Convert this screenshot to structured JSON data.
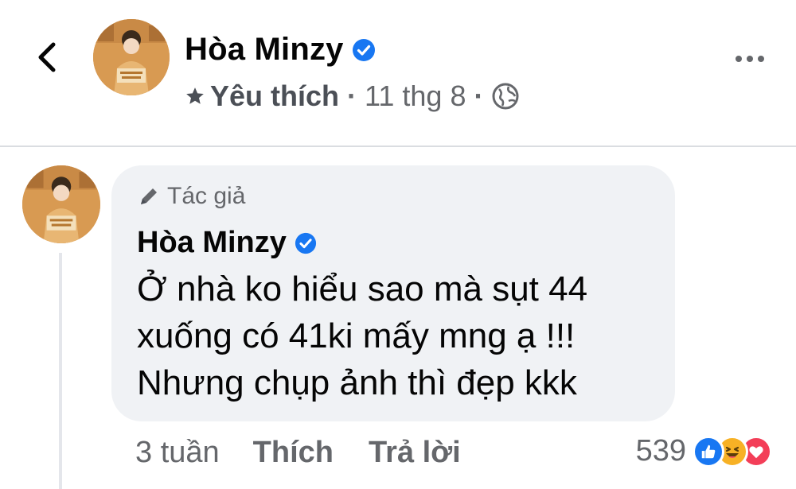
{
  "header": {
    "author_name": "Hòa Minzy",
    "favorite_label": "Yêu thích",
    "separator": "·",
    "date": "11 thg 8",
    "icons": {
      "back": "chevron-left-icon",
      "verified": "verified-badge-icon",
      "favorite": "star-icon",
      "privacy": "globe-icon",
      "more": "more-options-icon"
    }
  },
  "comment": {
    "badge_label": "Tác giả",
    "author_name": "Hòa Minzy",
    "text_lines": [
      "Ở nhà ko hiểu sao mà sụt 44",
      "xuống có 41ki mấy mng ạ !!!",
      "Nhưng chụp ảnh thì đẹp kkk"
    ],
    "time": "3 tuần",
    "like_label": "Thích",
    "reply_label": "Trả lời",
    "reaction_count": "539",
    "reactions": [
      "like",
      "haha",
      "love"
    ],
    "icons": {
      "badge": "pencil-icon",
      "verified": "verified-badge-icon"
    }
  },
  "colors": {
    "verified_blue": "#1877f2",
    "bubble_bg": "#f0f2f5",
    "secondary_text": "#65676b",
    "like_blue": "#1877f2",
    "haha_yellow": "#f7b125",
    "love_red": "#f33e58"
  }
}
